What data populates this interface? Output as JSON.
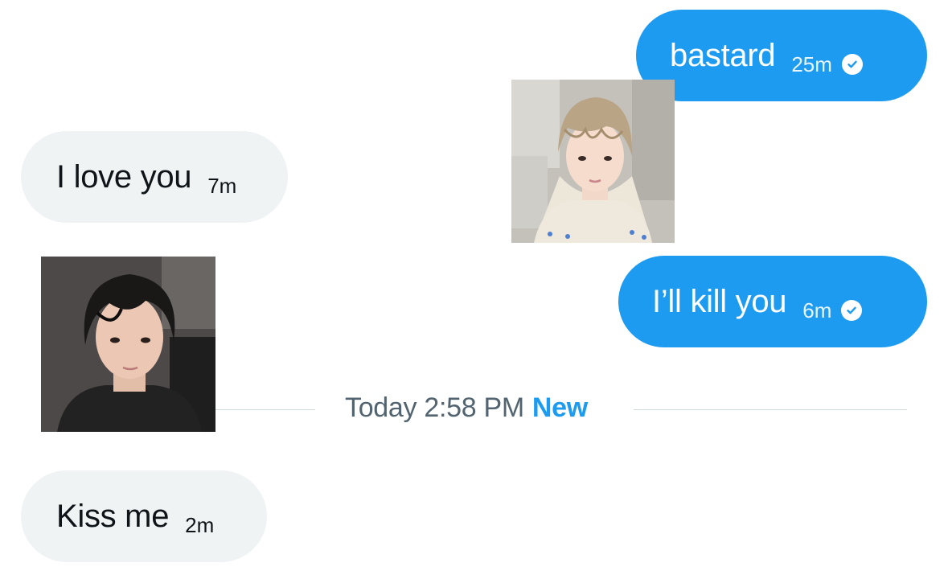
{
  "conversation": {
    "messages": [
      {
        "direction": "outgoing",
        "text": "bastard",
        "time": "25m",
        "status_icon": "check-circle-icon"
      },
      {
        "direction": "incoming",
        "text": "I love you",
        "time": "7m"
      },
      {
        "direction": "outgoing",
        "text": "I’ll kill you",
        "time": "6m",
        "status_icon": "check-circle-icon"
      },
      {
        "direction": "incoming",
        "text": "Kiss me",
        "time": "2m"
      }
    ],
    "divider": {
      "date_text": "Today 2:58 PM",
      "new_label": "New"
    }
  },
  "colors": {
    "outgoing_bubble": "#1d9bf0",
    "incoming_bubble": "#eff3f4",
    "divider_text": "#536471",
    "new_label": "#1d9bf0"
  }
}
